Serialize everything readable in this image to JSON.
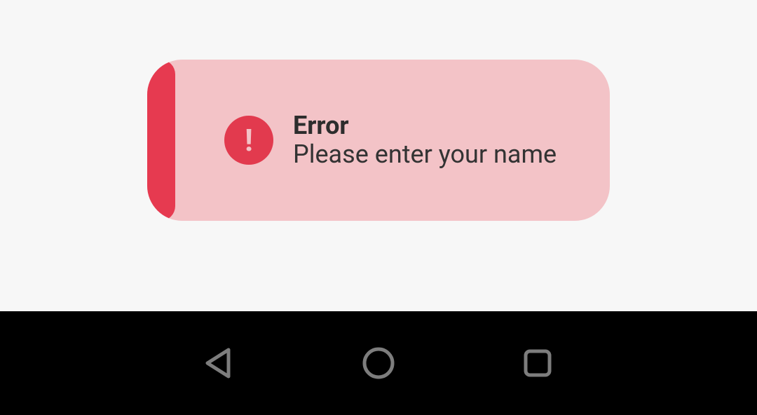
{
  "colors": {
    "alert_bg": "#f3c3c7",
    "alert_accent": "#e63a50",
    "alert_icon_bg": "#e23a4e",
    "text": "#2f2f2f",
    "page_bg": "#f7f7f7",
    "navbar_bg": "#000000",
    "nav_icon": "#7d7d7d"
  },
  "alert": {
    "icon_glyph": "!",
    "title": "Error",
    "message": "Please enter your name"
  },
  "navbar": {
    "back": "back",
    "home": "home",
    "recents": "recents"
  }
}
